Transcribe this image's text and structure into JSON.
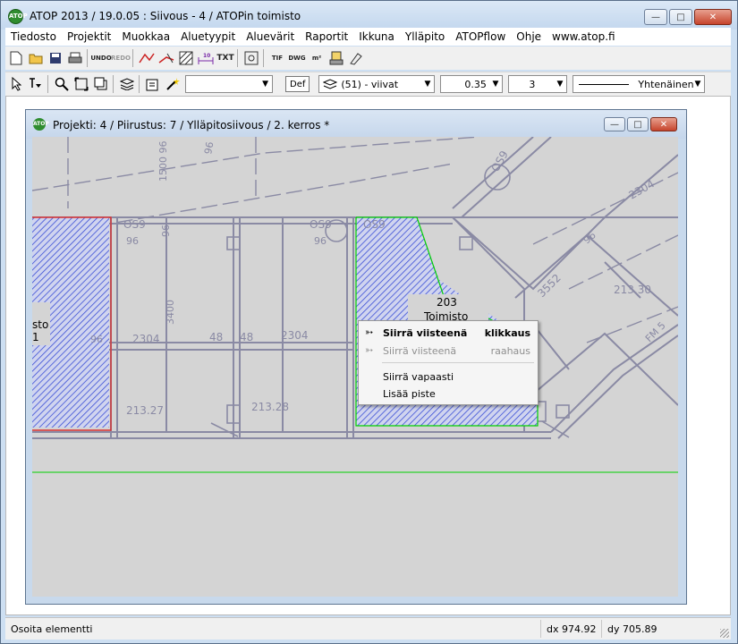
{
  "window": {
    "title": "ATOP 2013 / 19.0.05 : Siivous - 4 / ATOPin toimisto",
    "logo": "ATOP"
  },
  "menubar": {
    "items": [
      "Tiedosto",
      "Projektit",
      "Muokkaa",
      "Aluetyypit",
      "Aluevärit",
      "Raportit",
      "Ikkuna",
      "Ylläpito",
      "ATOPflow",
      "Ohje",
      "www.atop.fi"
    ]
  },
  "toolbar1": {
    "undo_label": "UNDO",
    "redo_label": "REDO",
    "txt_label": "TXT",
    "tif_label": "TIF",
    "dwg_label": "DWG",
    "area_label": "m²"
  },
  "toolbar2": {
    "select_value": "",
    "def_label": "Def",
    "layer_value": "(51) - viivat",
    "line_width": "0.35",
    "line_number": "3",
    "line_style": "Yhtenäinen"
  },
  "child_window": {
    "title": "Projekti: 4 / Piirustus: 7 / Ylläpitosiivous / 2. kerros *"
  },
  "drawing": {
    "labels": {
      "l1500": "1500 96",
      "l96a": "96",
      "l96b": "96",
      "l96c": "96",
      "l96d": "96",
      "l96e": "96",
      "os9a": "OS9",
      "os9b": "OS9",
      "os9c": "OS9",
      "os9d": "OS9",
      "l48a": "48",
      "l48b": "48",
      "l2304a": "2304",
      "l2304b": "2304",
      "l2304c": "2304",
      "l3400": "3400",
      "l3552": "3552",
      "l21330": "213.30",
      "l21327": "213.27",
      "l21328": "213.28",
      "l203": "203",
      "toimisto": "Toimisto",
      "sto": "sto",
      "l1": "1",
      "l96m": "96",
      "fms": "FM 5"
    },
    "colors": {
      "line": "#8a8aa4",
      "hatch": "#3b4fd6",
      "highlight": "#00d000",
      "room_red": "#d83030"
    }
  },
  "context_menu": {
    "items": [
      {
        "label": "Siirrä viisteenä",
        "accel": "klikkaus",
        "state": "bold",
        "icon": "pointer-edit-icon"
      },
      {
        "label": "Siirrä viisteenä",
        "accel": "raahaus",
        "state": "disabled",
        "icon": "pointer-edit-icon"
      },
      {
        "label": "Siirrä vapaasti",
        "accel": "",
        "state": "normal",
        "icon": ""
      },
      {
        "label": "Lisää piste",
        "accel": "",
        "state": "normal",
        "icon": ""
      }
    ]
  },
  "statusbar": {
    "message": "Osoita elementti",
    "dx": "dx 974.92",
    "dy": "dy 705.89"
  }
}
